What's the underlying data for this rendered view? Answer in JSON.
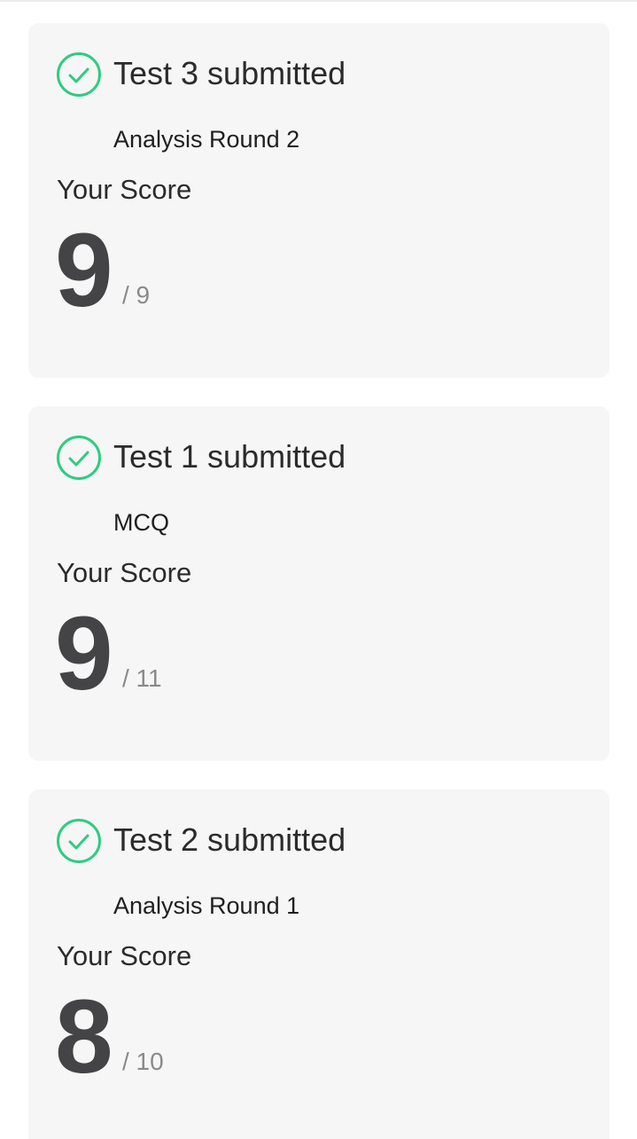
{
  "colors": {
    "accent_check": "#2ecc82",
    "card_background": "#f6f6f6",
    "score_value": "#444447",
    "score_total": "#8a8a8a"
  },
  "icons": {
    "submitted": "check-circle-icon"
  },
  "cards": [
    {
      "title": "Test 3 submitted",
      "subtitle": "Analysis Round 2",
      "score_label": "Your Score",
      "score": "9",
      "total": "/ 9"
    },
    {
      "title": "Test 1 submitted",
      "subtitle": "MCQ",
      "score_label": "Your Score",
      "score": "9",
      "total": "/ 11"
    },
    {
      "title": "Test 2 submitted",
      "subtitle": "Analysis Round 1",
      "score_label": "Your Score",
      "score": "8",
      "total": "/ 10"
    }
  ]
}
